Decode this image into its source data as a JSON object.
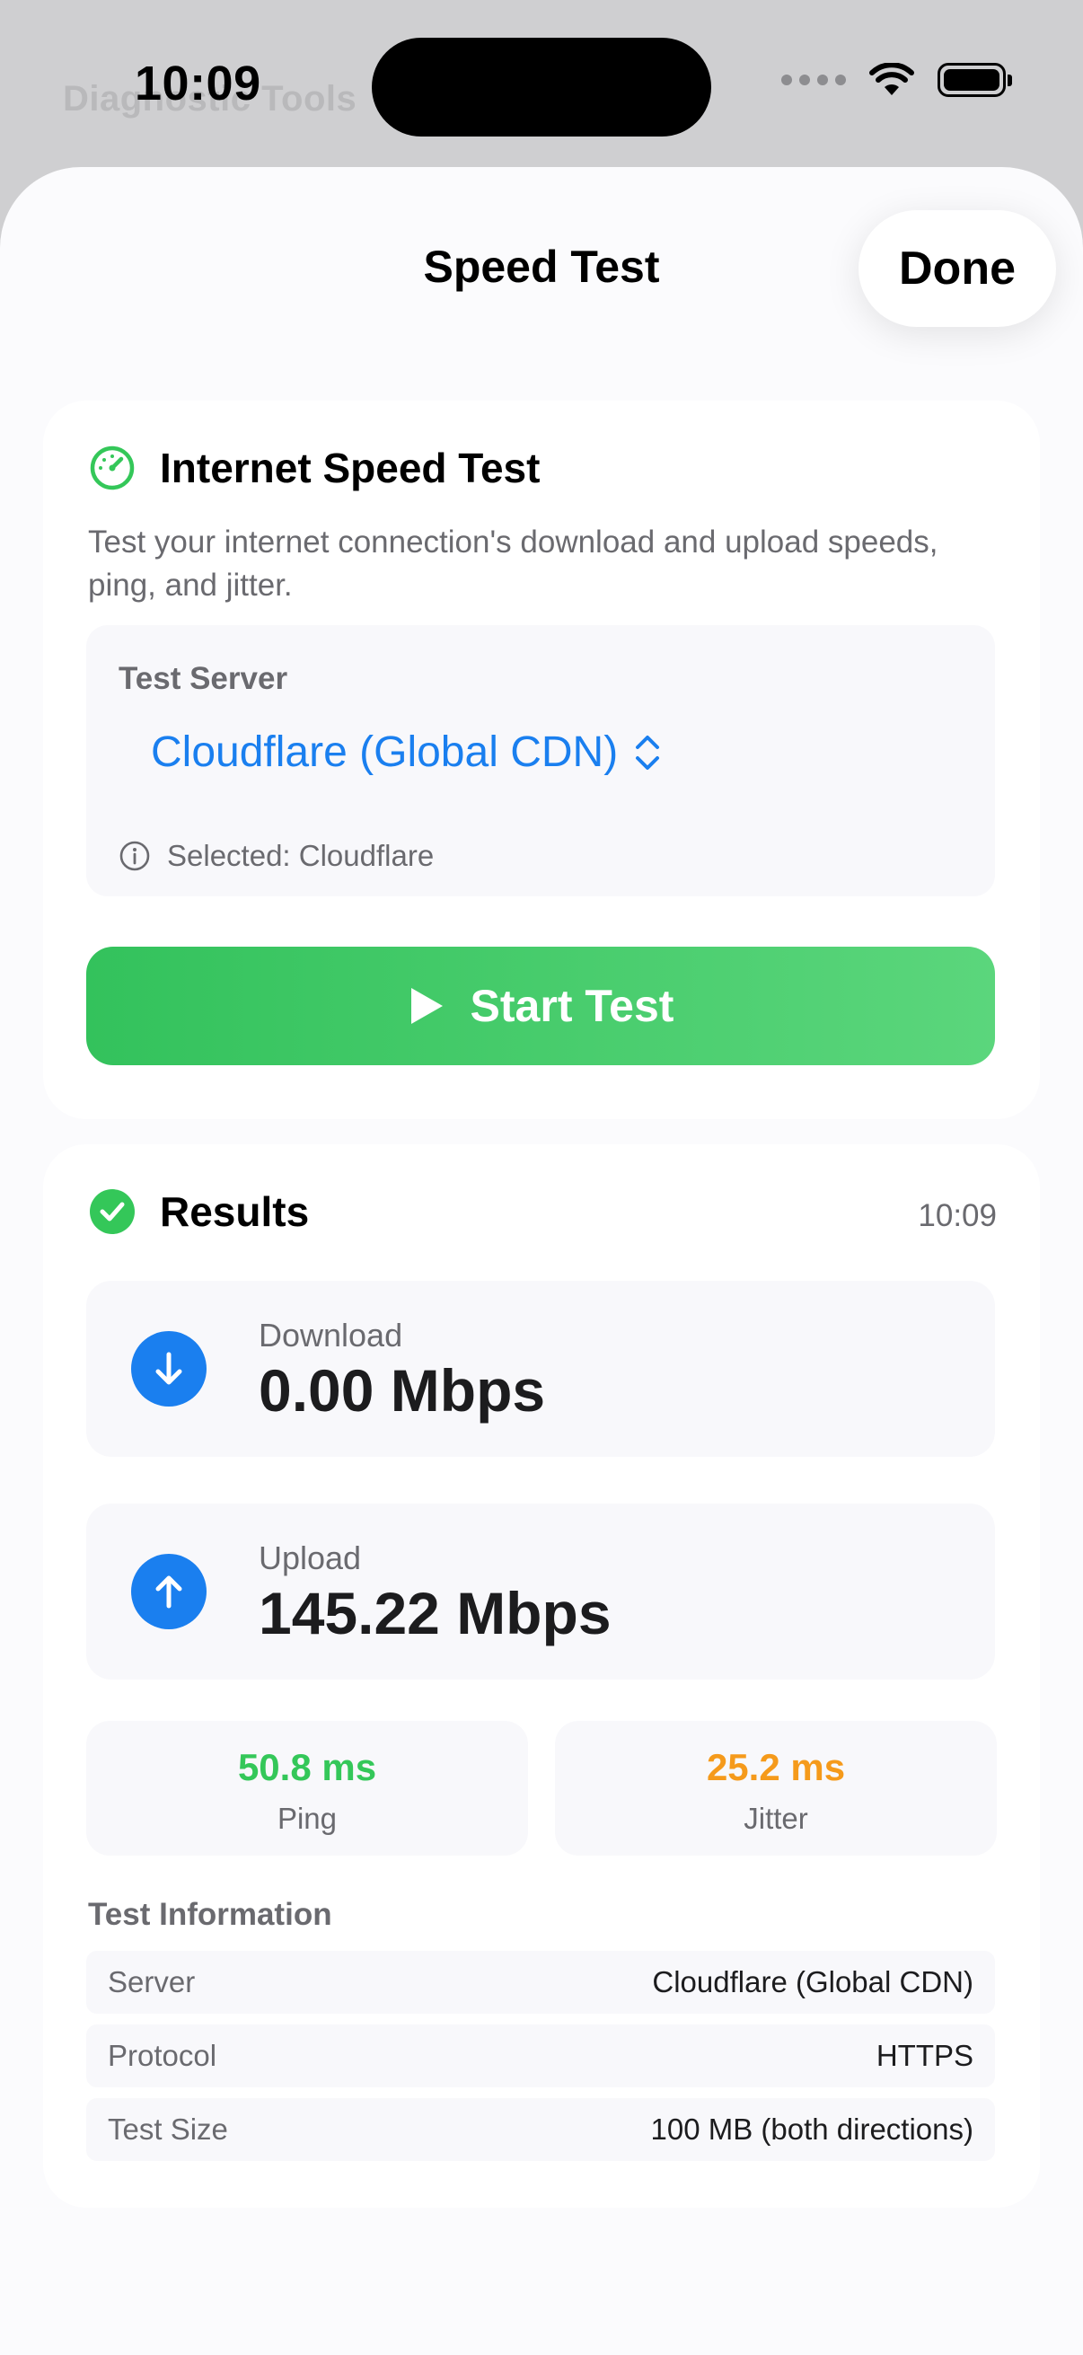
{
  "status_bar": {
    "time": "10:09",
    "background_title": "Diagnostic Tools"
  },
  "nav": {
    "title": "Speed Test",
    "done_label": "Done"
  },
  "speed_card": {
    "title": "Internet Speed Test",
    "description": "Test your internet connection's download and upload speeds, ping, and jitter.",
    "server_label": "Test Server",
    "server_value": "Cloudflare (Global CDN)",
    "selected_note": "Selected: Cloudflare",
    "start_label": "Start Test"
  },
  "results": {
    "title": "Results",
    "time": "10:09",
    "download": {
      "label": "Download",
      "value": "0.00 Mbps"
    },
    "upload": {
      "label": "Upload",
      "value": "145.22 Mbps"
    },
    "ping": {
      "value": "50.8 ms",
      "label": "Ping"
    },
    "jitter": {
      "value": "25.2 ms",
      "label": "Jitter"
    },
    "info_title": "Test Information",
    "info": [
      {
        "key": "Server",
        "value": "Cloudflare (Global CDN)"
      },
      {
        "key": "Protocol",
        "value": "HTTPS"
      },
      {
        "key": "Test Size",
        "value": "100 MB (both directions)"
      }
    ]
  },
  "colors": {
    "accent_blue": "#1a7fef",
    "success_green": "#34c759",
    "ping_green": "#34c759",
    "jitter_orange": "#f59a1b"
  }
}
